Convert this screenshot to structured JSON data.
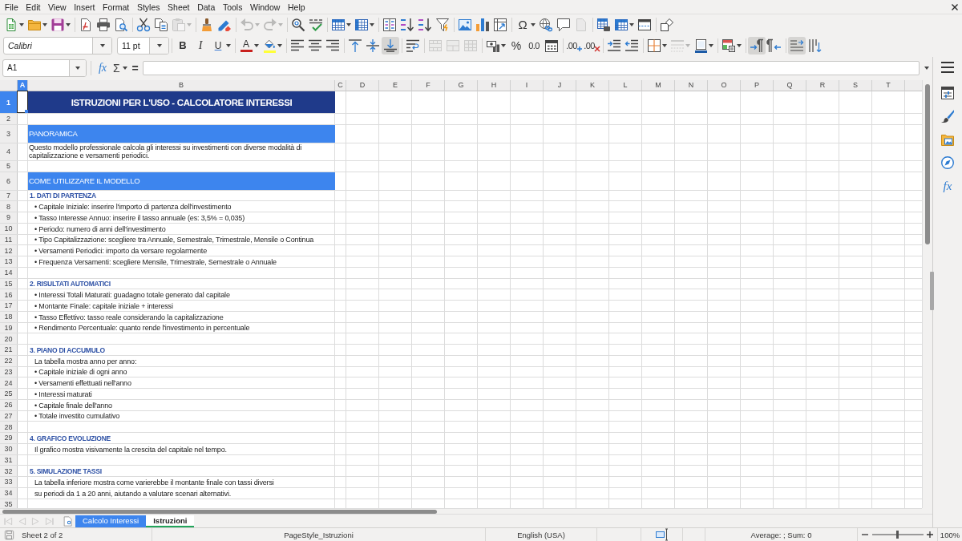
{
  "menu_bar": [
    "File",
    "Edit",
    "View",
    "Insert",
    "Format",
    "Styles",
    "Sheet",
    "Data",
    "Tools",
    "Window",
    "Help"
  ],
  "standard_toolbar": {
    "groups": [
      [
        {
          "kind": "split",
          "disabled": false
        },
        {
          "kind": "split",
          "disabled": false
        },
        {
          "kind": "split",
          "disabled": false
        }
      ],
      [
        {
          "kind": "button",
          "disabled": false
        },
        {
          "kind": "button",
          "disabled": false
        },
        {
          "kind": "button",
          "disabled": false
        }
      ],
      [
        {
          "kind": "button",
          "disabled": false
        },
        {
          "kind": "button",
          "disabled": false
        },
        {
          "kind": "split",
          "disabled": true
        }
      ],
      [
        {
          "kind": "button",
          "disabled": false
        },
        {
          "kind": "button",
          "disabled": false
        }
      ],
      [
        {
          "kind": "split",
          "disabled": true
        },
        {
          "kind": "split",
          "disabled": true
        }
      ],
      [
        {
          "kind": "button",
          "disabled": false
        },
        {
          "kind": "button",
          "disabled": false
        }
      ],
      [
        {
          "kind": "split",
          "disabled": false
        },
        {
          "kind": "split",
          "disabled": false
        }
      ],
      [
        {
          "kind": "button",
          "disabled": false
        },
        {
          "kind": "button",
          "disabled": false
        },
        {
          "kind": "button",
          "disabled": false
        },
        {
          "kind": "button",
          "disabled": false
        }
      ],
      [
        {
          "kind": "button",
          "disabled": false
        },
        {
          "kind": "button",
          "disabled": false
        },
        {
          "kind": "button",
          "disabled": false
        }
      ],
      [
        {
          "kind": "split",
          "disabled": false,
          "label": "Ω"
        },
        {
          "kind": "button",
          "disabled": false
        },
        {
          "kind": "button",
          "disabled": false
        },
        {
          "kind": "button",
          "disabled": true
        }
      ],
      [
        {
          "kind": "button",
          "disabled": false
        },
        {
          "kind": "split",
          "disabled": false
        },
        {
          "kind": "button",
          "disabled": false
        }
      ],
      [
        {
          "kind": "button",
          "disabled": false
        }
      ]
    ]
  },
  "formatting_toolbar": {
    "font_name": "Calibri",
    "font_size": "11 pt",
    "groups": [
      [
        {
          "kind": "button",
          "label": "B",
          "disabled": false,
          "on": false
        },
        {
          "kind": "button",
          "label": "I",
          "disabled": false,
          "on": false
        },
        {
          "kind": "split",
          "label": "U",
          "disabled": false,
          "on": false
        }
      ],
      [
        {
          "kind": "split",
          "label": "A",
          "color": "#c9211e",
          "disabled": false,
          "on": false
        },
        {
          "kind": "split",
          "color": "#ffff38",
          "disabled": false,
          "on": false
        }
      ],
      [
        {
          "kind": "button",
          "disabled": false,
          "on": false
        },
        {
          "kind": "button",
          "disabled": false,
          "on": false
        },
        {
          "kind": "button",
          "disabled": false,
          "on": false
        }
      ],
      [
        {
          "kind": "button",
          "disabled": false,
          "on": false
        },
        {
          "kind": "button",
          "disabled": false,
          "on": false
        },
        {
          "kind": "button",
          "disabled": false,
          "on": true
        }
      ],
      [
        {
          "kind": "button",
          "disabled": false,
          "on": false
        }
      ],
      [
        {
          "kind": "button",
          "disabled": true,
          "on": false
        },
        {
          "kind": "button",
          "disabled": true,
          "on": false
        },
        {
          "kind": "button",
          "disabled": true,
          "on": false
        }
      ],
      [
        {
          "kind": "split",
          "disabled": false,
          "on": false
        },
        {
          "kind": "button",
          "label": "%",
          "disabled": false,
          "on": false
        },
        {
          "kind": "button",
          "label": "0.0",
          "disabled": false,
          "on": false
        },
        {
          "kind": "button",
          "disabled": false,
          "on": false
        }
      ],
      [
        {
          "kind": "button",
          "label": ".00",
          "disabled": false,
          "on": false
        },
        {
          "kind": "button",
          "label": ".00",
          "disabled": false,
          "on": false
        }
      ],
      [
        {
          "kind": "button",
          "disabled": false,
          "on": false
        },
        {
          "kind": "button",
          "disabled": false,
          "on": false
        }
      ],
      [
        {
          "kind": "split",
          "disabled": false,
          "on": false
        },
        {
          "kind": "split",
          "disabled": true,
          "on": false
        },
        {
          "kind": "split",
          "color": "#1c5aa6",
          "disabled": false,
          "on": false
        }
      ],
      [
        {
          "kind": "split",
          "disabled": false,
          "on": false
        }
      ],
      [
        {
          "kind": "button",
          "disabled": false,
          "on": true
        },
        {
          "kind": "button",
          "disabled": false,
          "on": false
        }
      ],
      [
        {
          "kind": "button",
          "disabled": false,
          "on": true
        },
        {
          "kind": "button",
          "disabled": false,
          "on": false
        }
      ]
    ]
  },
  "formula_bar": {
    "name_box": "A1",
    "function_wizard": "fx",
    "sum": "Σ",
    "formula": "="
  },
  "sheet": {
    "columns": [
      {
        "label": "A",
        "selected": true
      },
      {
        "label": "B",
        "selected": false
      },
      {
        "label": "C",
        "selected": false
      },
      {
        "label": "D",
        "selected": false
      },
      {
        "label": "E",
        "selected": false
      },
      {
        "label": "F",
        "selected": false
      },
      {
        "label": "G",
        "selected": false
      },
      {
        "label": "H",
        "selected": false
      },
      {
        "label": "I",
        "selected": false
      },
      {
        "label": "J",
        "selected": false
      },
      {
        "label": "K",
        "selected": false
      },
      {
        "label": "L",
        "selected": false
      },
      {
        "label": "M",
        "selected": false
      },
      {
        "label": "N",
        "selected": false
      },
      {
        "label": "O",
        "selected": false
      },
      {
        "label": "P",
        "selected": false
      },
      {
        "label": "Q",
        "selected": false
      },
      {
        "label": "R",
        "selected": false
      },
      {
        "label": "S",
        "selected": false
      },
      {
        "label": "T",
        "selected": false
      }
    ],
    "rows": [
      {
        "number": "1",
        "selected": true,
        "kind": "title",
        "text": "ISTRUZIONI PER L'USO - CALCOLATORE INTERESSI"
      },
      {
        "number": "2",
        "selected": false,
        "kind": "blank"
      },
      {
        "number": "3",
        "selected": false,
        "kind": "section",
        "text": "PANORAMICA"
      },
      {
        "number": "4",
        "selected": false,
        "kind": "paragraph",
        "text": "Questo modello professionale calcola gli interessi su investimenti con diverse modalità di capitalizzazione e versamenti periodici."
      },
      {
        "number": "5",
        "selected": false,
        "kind": "blank"
      },
      {
        "number": "6",
        "selected": false,
        "kind": "section",
        "text": "COME UTILIZZARE IL MODELLO"
      },
      {
        "number": "7",
        "selected": false,
        "kind": "heading",
        "text": "1. DATI DI PARTENZA"
      },
      {
        "number": "8",
        "selected": false,
        "kind": "bullet",
        "text": "• Capitale Iniziale: inserire l'importo di partenza dell'investimento"
      },
      {
        "number": "9",
        "selected": false,
        "kind": "bullet",
        "text": "• Tasso Interesse Annuo: inserire il tasso annuale (es: 3,5% = 0,035)"
      },
      {
        "number": "10",
        "selected": false,
        "kind": "bullet",
        "text": "• Periodo: numero di anni dell'investimento"
      },
      {
        "number": "11",
        "selected": false,
        "kind": "bullet",
        "text": "• Tipo Capitalizzazione: scegliere tra Annuale, Semestrale, Trimestrale, Mensile o Continua"
      },
      {
        "number": "12",
        "selected": false,
        "kind": "bullet",
        "text": "• Versamenti Periodici: importo da versare regolarmente"
      },
      {
        "number": "13",
        "selected": false,
        "kind": "bullet",
        "text": "• Frequenza Versamenti: scegliere Mensile, Trimestrale, Semestrale o Annuale"
      },
      {
        "number": "14",
        "selected": false,
        "kind": "blank"
      },
      {
        "number": "15",
        "selected": false,
        "kind": "heading",
        "text": "2. RISULTATI AUTOMATICI"
      },
      {
        "number": "16",
        "selected": false,
        "kind": "bullet",
        "text": "• Interessi Totali Maturati: guadagno totale generato dal capitale"
      },
      {
        "number": "17",
        "selected": false,
        "kind": "bullet",
        "text": "• Montante Finale: capitale iniziale + interessi"
      },
      {
        "number": "18",
        "selected": false,
        "kind": "bullet",
        "text": "• Tasso Effettivo: tasso reale considerando la capitalizzazione"
      },
      {
        "number": "19",
        "selected": false,
        "kind": "bullet",
        "text": "• Rendimento Percentuale: quanto rende l'investimento in percentuale"
      },
      {
        "number": "20",
        "selected": false,
        "kind": "blank"
      },
      {
        "number": "21",
        "selected": false,
        "kind": "heading",
        "text": "3. PIANO DI ACCUMULO"
      },
      {
        "number": "22",
        "selected": false,
        "kind": "text",
        "text": "La tabella mostra anno per anno:"
      },
      {
        "number": "23",
        "selected": false,
        "kind": "bullet",
        "text": "• Capitale iniziale di ogni anno"
      },
      {
        "number": "24",
        "selected": false,
        "kind": "bullet",
        "text": "• Versamenti effettuati nell'anno"
      },
      {
        "number": "25",
        "selected": false,
        "kind": "bullet",
        "text": "• Interessi maturati"
      },
      {
        "number": "26",
        "selected": false,
        "kind": "bullet",
        "text": "• Capitale finale dell'anno"
      },
      {
        "number": "27",
        "selected": false,
        "kind": "bullet",
        "text": "• Totale investito cumulativo"
      },
      {
        "number": "28",
        "selected": false,
        "kind": "blank"
      },
      {
        "number": "29",
        "selected": false,
        "kind": "heading",
        "text": "4. GRAFICO EVOLUZIONE"
      },
      {
        "number": "30",
        "selected": false,
        "kind": "text",
        "text": "Il grafico mostra visivamente la crescita del capitale nel tempo."
      },
      {
        "number": "31",
        "selected": false,
        "kind": "blank"
      },
      {
        "number": "32",
        "selected": false,
        "kind": "heading",
        "text": "5. SIMULAZIONE TASSI"
      },
      {
        "number": "33",
        "selected": false,
        "kind": "text",
        "text": "La tabella inferiore mostra come varierebbe il montante finale con tassi diversi"
      },
      {
        "number": "34",
        "selected": false,
        "kind": "text",
        "text": "su periodi da 1 a 20 anni, aiutando a valutare scenari alternativi."
      },
      {
        "number": "35",
        "selected": false,
        "kind": "blank"
      }
    ]
  },
  "sheet_tabs": {
    "navigation": [
      {
        "disabled": true
      },
      {
        "disabled": true
      },
      {
        "disabled": true
      },
      {
        "disabled": true
      }
    ],
    "tabs": [
      {
        "label": "Calcolo Interessi",
        "selected": false,
        "color": "#3d85ee"
      },
      {
        "label": "Istruzioni",
        "selected": true,
        "color": "#22a55b"
      }
    ]
  },
  "sidebar": {
    "functions": "fx"
  },
  "status_bar": {
    "sheet": "Sheet 2 of 2",
    "page_style": "PageStyle_Istruzioni",
    "language": "English (USA)",
    "summary": "Average: ; Sum: 0",
    "zoom": {
      "level": 0.5,
      "reading": "100%"
    }
  }
}
